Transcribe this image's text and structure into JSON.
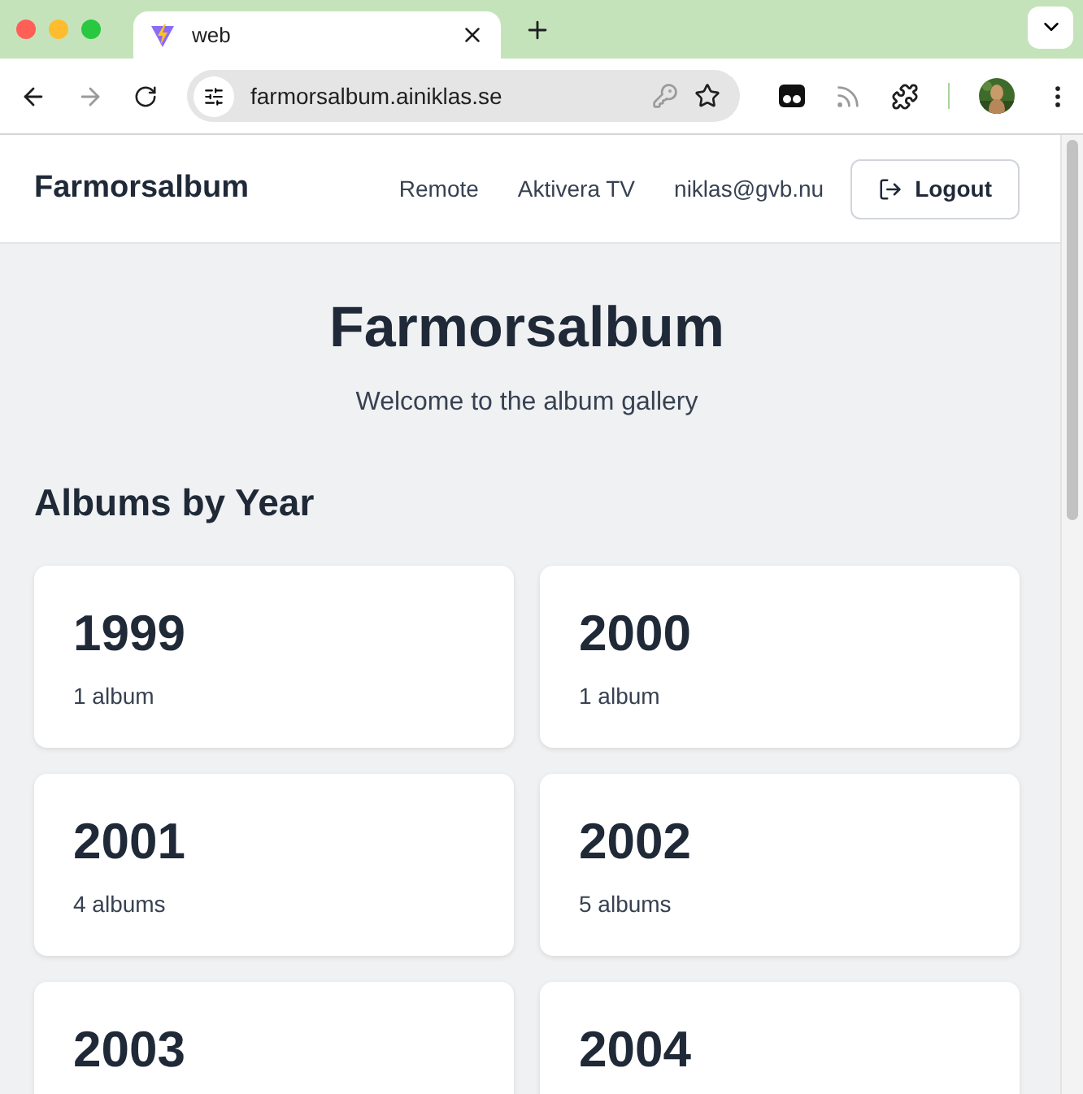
{
  "browser": {
    "tabs": [
      {
        "title": "web",
        "selected": true
      }
    ],
    "address": "farmorsalbum.ainiklas.se"
  },
  "nav": {
    "brand": "Farmorsalbum",
    "links": [
      "Remote",
      "Aktivera TV",
      "niklas@gvb.nu"
    ],
    "logout": "Logout"
  },
  "hero": {
    "title": "Farmorsalbum",
    "subtitle": "Welcome to the album gallery"
  },
  "section_title": "Albums by Year",
  "albums": [
    {
      "year": "1999",
      "count": "1 album"
    },
    {
      "year": "2000",
      "count": "1 album"
    },
    {
      "year": "2001",
      "count": "4 albums"
    },
    {
      "year": "2002",
      "count": "5 albums"
    },
    {
      "year": "2003"
    },
    {
      "year": "2004"
    }
  ]
}
